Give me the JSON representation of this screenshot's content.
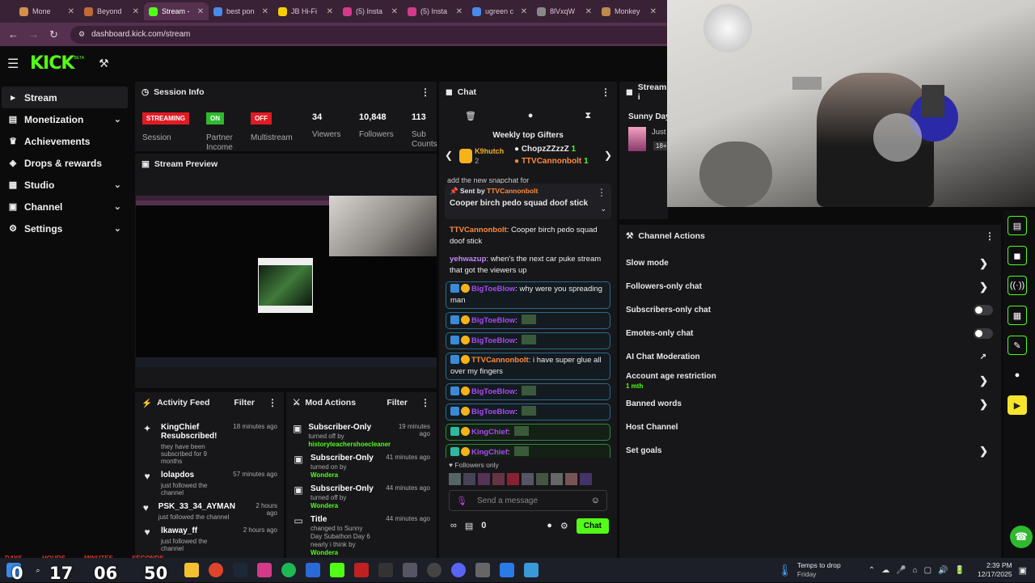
{
  "browser": {
    "tabs": [
      {
        "title": "Mone",
        "color": "#d4904a"
      },
      {
        "title": "Beyond",
        "color": "#c06a38"
      },
      {
        "title": "Stream -",
        "color": "#53fc18"
      },
      {
        "title": "best pon",
        "color": "#4a8ae8"
      },
      {
        "title": "JB Hi-Fi",
        "color": "#f5d000"
      },
      {
        "title": "(5) Insta",
        "color": "#d43a8a"
      },
      {
        "title": "(5) Insta",
        "color": "#d43a8a"
      },
      {
        "title": "ugreen c",
        "color": "#4a8ae8"
      },
      {
        "title": "8lVxqW",
        "color": "#888888"
      },
      {
        "title": "Monkey",
        "color": "#c08a4a"
      }
    ],
    "url": "dashboard.kick.com/stream"
  },
  "header": {
    "logo": "KICK",
    "beta": "BETA"
  },
  "sidebar": {
    "items": [
      {
        "label": "Stream",
        "icon": "stream-icon",
        "chevron": false
      },
      {
        "label": "Monetization",
        "icon": "money-icon",
        "chevron": true
      },
      {
        "label": "Achievements",
        "icon": "trophy-icon",
        "chevron": false
      },
      {
        "label": "Drops & rewards",
        "icon": "gift-icon",
        "chevron": false
      },
      {
        "label": "Studio",
        "icon": "studio-icon",
        "chevron": true
      },
      {
        "label": "Channel",
        "icon": "channel-icon",
        "chevron": true
      },
      {
        "label": "Settings",
        "icon": "gear-icon",
        "chevron": true
      }
    ]
  },
  "session": {
    "title": "Session Info",
    "streaming": "STREAMING",
    "session_lbl": "Session",
    "on": "ON",
    "partner_lbl": "Partner Income",
    "off": "OFF",
    "multi_lbl": "Multistream",
    "viewers": "34",
    "viewers_lbl": "Viewers",
    "followers": "10,848",
    "followers_lbl": "Followers",
    "subs": "113",
    "subs_lbl": "Sub Counts"
  },
  "preview": {
    "title": "Stream Preview"
  },
  "activity": {
    "title": "Activity Feed",
    "filter": "Filter",
    "items": [
      {
        "name": "KingChief Resubscribed!",
        "sub": "they have been subscribed for 9 months",
        "time": "18 minutes ago"
      },
      {
        "name": "lolapdos",
        "sub": "just followed the channel",
        "time": "57 minutes ago"
      },
      {
        "name": "PSK_33_34_AYMAN",
        "sub": "just followed the channel",
        "time": "2 hours ago"
      },
      {
        "name": "lkaway_ff",
        "sub": "just followed the channel",
        "time": "2 hours ago"
      }
    ]
  },
  "mod": {
    "title": "Mod Actions",
    "filter": "Filter",
    "items": [
      {
        "name": "Subscriber-Only",
        "sub": "turned off by",
        "who": "historyteachershoecleaner",
        "time": "19 minutes ago"
      },
      {
        "name": "Subscriber-Only",
        "sub": "turned on by",
        "who": "Wondera",
        "time": "41 minutes ago"
      },
      {
        "name": "Subscriber-Only",
        "sub": "turned off by",
        "who": "Wondera",
        "time": "44 minutes ago"
      },
      {
        "name": "Title",
        "sub": "changed to Sunny Day Subathon Day 6 nearly i think by",
        "who": "Wondera",
        "time": "44 minutes ago"
      }
    ]
  },
  "chat": {
    "title": "Chat",
    "gifters_title": "Weekly top Gifters",
    "gifters": [
      {
        "name": "K9hutch",
        "count": "2"
      },
      {
        "name": "ChopzZZzzZ",
        "count": "1"
      },
      {
        "name": "TTVCannonbolt",
        "count": "1"
      }
    ],
    "pinned_by": "Sent by",
    "pinned_user": "TTVCannonbolt",
    "pinned_text": "Cooper birch pedo squad doof stick",
    "partial_top": "add the new snapchat for",
    "messages": [
      {
        "user": "TTVCannonbolt",
        "color": "#ff8a3a",
        "text": "Cooper birch pedo squad doof stick",
        "style": "plain"
      },
      {
        "user": "yehwazup",
        "color": "#c18af5",
        "text": "when's the next car puke stream that got the viewers up",
        "style": "plain"
      },
      {
        "user": "BigToeBlow",
        "color": "#a94af5",
        "text": "why were you spreading man",
        "style": "box"
      },
      {
        "user": "BigToeBlow",
        "color": "#a94af5",
        "text": "",
        "style": "box"
      },
      {
        "user": "BigToeBlow",
        "color": "#a94af5",
        "text": "",
        "style": "box"
      },
      {
        "user": "TTVCannonbolt",
        "color": "#ff8a3a",
        "text": "i have super glue all over my fingers",
        "style": "box"
      },
      {
        "user": "BigToeBlow",
        "color": "#a94af5",
        "text": "",
        "style": "box"
      },
      {
        "user": "BigToeBlow",
        "color": "#a94af5",
        "text": "",
        "style": "box"
      },
      {
        "user": "KingChief",
        "color": "#a94af5",
        "text": "",
        "style": "boxg"
      },
      {
        "user": "KingChief",
        "color": "#a94af5",
        "text": "",
        "style": "boxg"
      },
      {
        "user": "BigToeBlow",
        "color": "#a94af5",
        "text": "",
        "style": "box"
      },
      {
        "user": "BigToeBlow",
        "color": "#a94af5",
        "text": "",
        "style": "box"
      }
    ],
    "followers_only": "Followers only",
    "input_placeholder": "Send a message",
    "count": "0",
    "send": "Chat"
  },
  "streaminfo": {
    "title": "Stream i",
    "stream_title": "Sunny Day",
    "sub": "Just",
    "age": "18+"
  },
  "actions": {
    "title": "Channel Actions",
    "items": [
      {
        "label": "Slow mode",
        "kind": "chevron"
      },
      {
        "label": "Followers-only chat",
        "kind": "chevron"
      },
      {
        "label": "Subscribers-only chat",
        "kind": "toggle"
      },
      {
        "label": "Emotes-only chat",
        "kind": "toggle"
      },
      {
        "label": "AI Chat Moderation",
        "kind": "external"
      },
      {
        "label": "Account age restriction",
        "sub": "1 mth",
        "kind": "chevron"
      },
      {
        "label": "Banned words",
        "kind": "chevron"
      },
      {
        "label": "Host Channel",
        "kind": "none"
      },
      {
        "label": "Set goals",
        "kind": "chevron"
      }
    ]
  },
  "countdown": {
    "days": "0",
    "hours": "17",
    "minutes": "06",
    "seconds": "50",
    "days_lbl": "DAYS",
    "hours_lbl": "HOURS",
    "minutes_lbl": "MINUTES",
    "seconds_lbl": "SECONDS"
  },
  "taskbar": {
    "weather_title": "Temps to drop",
    "weather_sub": "Friday",
    "time": "2:39 PM",
    "date": "12/17/2025"
  }
}
